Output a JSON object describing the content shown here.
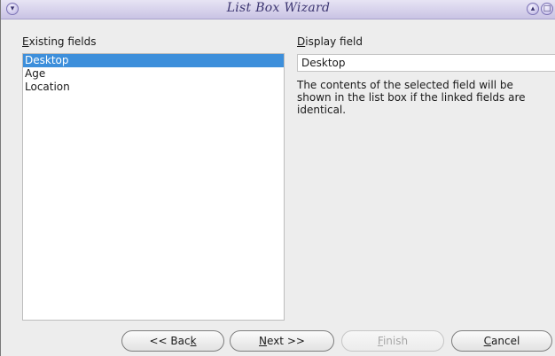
{
  "window": {
    "title": "List Box Wizard",
    "titlebar_buttons": [
      "menu-icon",
      "rollup-icon",
      "maximize-icon"
    ]
  },
  "left_panel": {
    "label_mnemonic": "E",
    "label_rest": "xisting fields",
    "items": [
      {
        "label": "Desktop",
        "selected": true
      },
      {
        "label": "Age",
        "selected": false
      },
      {
        "label": "Location",
        "selected": false
      }
    ]
  },
  "right_panel": {
    "label_mnemonic": "D",
    "label_rest": "isplay field",
    "value": "Desktop",
    "description": "The contents of the selected field will be shown in the list box if the linked fields are identical."
  },
  "buttons": {
    "back": {
      "prefix": "<< Bac",
      "mnemonic": "k",
      "suffix": ""
    },
    "next": {
      "prefix": "",
      "mnemonic": "N",
      "suffix": "ext >>"
    },
    "finish": {
      "prefix": "",
      "mnemonic": "F",
      "suffix": "inish",
      "enabled": false
    },
    "cancel": {
      "prefix": "",
      "mnemonic": "C",
      "suffix": "ancel"
    }
  },
  "colors": {
    "titlebar": "#c9c3e4",
    "selection": "#3d8fdb"
  }
}
